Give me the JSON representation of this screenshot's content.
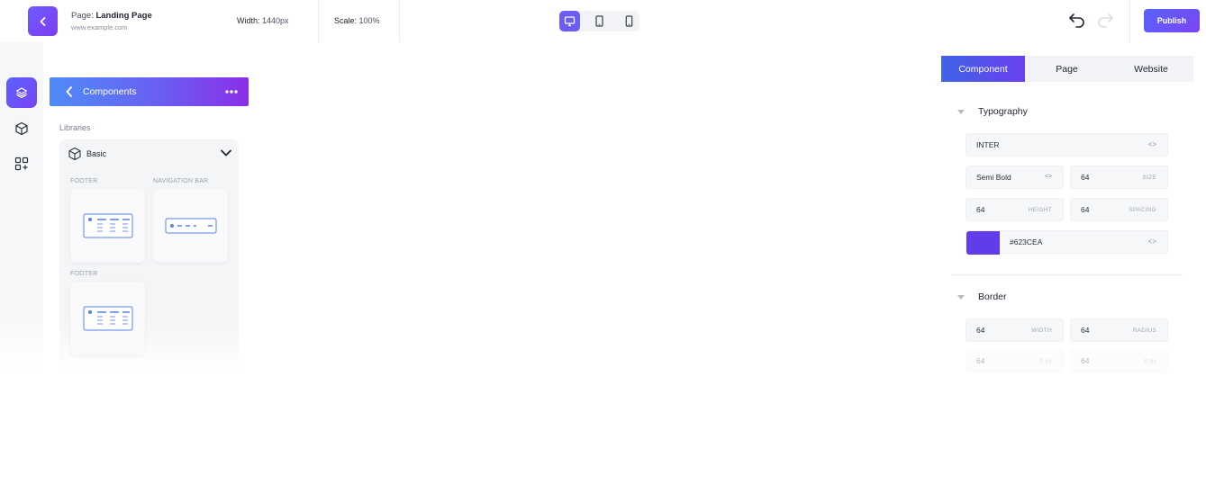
{
  "header": {
    "page_prefix": "Page:",
    "page_name": "Landing Page",
    "url": "www.example.com",
    "width_label": "Width:",
    "width_value": "1440px",
    "scale_label": "Scale:",
    "scale_value": "100%",
    "publish_label": "Publish",
    "devices": [
      "desktop-icon",
      "tablet-icon",
      "mobile-icon"
    ],
    "active_device": "desktop"
  },
  "rail": {
    "items": [
      "layers-icon",
      "cube-icon",
      "add-widget-icon"
    ],
    "active": "layers"
  },
  "components_panel": {
    "title": "Components",
    "libraries_label": "Libraries",
    "library": {
      "name": "Basic",
      "sections": [
        {
          "label": "FOOTER"
        },
        {
          "label": "NAVIGATION BAR"
        },
        {
          "label": "FOOTER"
        }
      ]
    }
  },
  "inspector": {
    "tabs": [
      {
        "label": "Component",
        "active": true
      },
      {
        "label": "Page",
        "active": false
      },
      {
        "label": "Website",
        "active": false
      }
    ],
    "typography": {
      "title": "Typography",
      "font": "INTER",
      "code_glyph": "<>",
      "weight": "Semi Bold",
      "size_value": "64",
      "size_unit": "SIZE",
      "height_value": "64",
      "height_unit": "HEIGHT",
      "spacing_value": "64",
      "spacing_unit": "SPACING",
      "color_hex": "#623CEA"
    },
    "border": {
      "title": "Border",
      "width_value": "64",
      "width_unit": "WIDTH",
      "radius_value": "64",
      "radius_unit": "RADIUS",
      "extra_left_value": "64",
      "extra_left_unit": "0 px",
      "extra_right_value": "64",
      "extra_right_unit": "0 px"
    }
  },
  "colors": {
    "accent": "#623CEA",
    "accent_blue": "#4E8CF7"
  }
}
